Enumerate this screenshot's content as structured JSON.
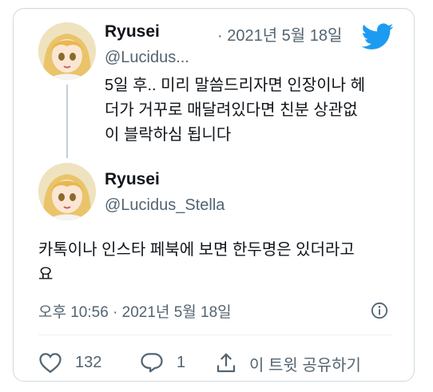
{
  "parent_tweet": {
    "name": "Ryusei",
    "handle": "@Lucidus...",
    "date": "· 2021년 5월 18일",
    "text_lines": [
      "5일 후.. 미리 말씀드리자면 인장이나 헤",
      "더가 거꾸로 매달려있다면 친분 상관없",
      "이 블락하심 됩니다"
    ]
  },
  "main_tweet": {
    "name": "Ryusei",
    "handle": "@Lucidus_Stella",
    "text_lines": [
      "카톡이나 인스타 페북에 보면 한두명은 있더라고",
      "요"
    ],
    "timestamp": "오후 10:56 · 2021년 5월 18일"
  },
  "actions": {
    "like_count": "132",
    "reply_count": "1",
    "share_label": "이 트윗 공유하기"
  },
  "icons": {
    "logo": "twitter-bird-icon",
    "info": "info-icon",
    "like": "heart-icon",
    "reply": "reply-icon",
    "share": "share-icon"
  },
  "colors": {
    "brand": "#1d9bf0",
    "text_primary": "#0f1419",
    "text_secondary": "#536471",
    "border": "#cfd9de"
  }
}
